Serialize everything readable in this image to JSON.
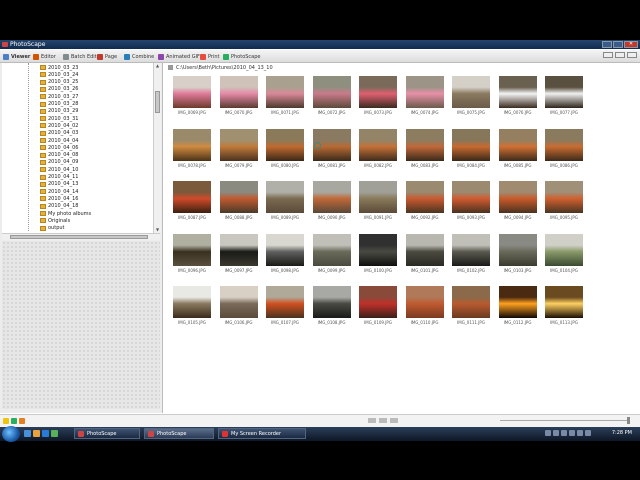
{
  "window": {
    "title": "PhotoScape"
  },
  "tabs": [
    {
      "label": "Viewer",
      "color": "#4a7fc8",
      "active": true
    },
    {
      "label": "Editor",
      "color": "#d35400"
    },
    {
      "label": "Batch Editor",
      "color": "#7f8c8d"
    },
    {
      "label": "Page",
      "color": "#c0392b"
    },
    {
      "label": "Combine",
      "color": "#2980b9"
    },
    {
      "label": "Animated GIF",
      "color": "#8e44ad"
    },
    {
      "label": "Print",
      "color": "#e74c3c"
    },
    {
      "label": "PhotoScape",
      "color": "#27ae60"
    }
  ],
  "tree": {
    "folders": [
      "2010_03_23",
      "2010_03_24",
      "2010_03_25",
      "2010_03_26",
      "2010_03_27",
      "2010_03_28",
      "2010_03_29",
      "2010_03_31",
      "2010_04_02",
      "2010_04_03",
      "2010_04_04",
      "2010_04_06",
      "2010_04_08",
      "2010_04_09",
      "2010_04_10",
      "2010_04_11",
      "2010_04_13",
      "2010_04_14",
      "2010_04_16",
      "2010_04_18",
      "My photo albums",
      "Originals",
      "output"
    ]
  },
  "path": "C:\\Users\\Beth\\Pictures\\2010_04_13_10",
  "thumbs": [
    {
      "name": "IMG_0069.JPG",
      "c1": "#d8d0c8",
      "c2": "#6b3a2a",
      "c3": "#e07a9a"
    },
    {
      "name": "IMG_0070.JPG",
      "c1": "#cfc2b8",
      "c2": "#5a3a30",
      "c3": "#e58aa8"
    },
    {
      "name": "IMG_0071.JPG",
      "c1": "#a9a090",
      "c2": "#4a3a2c",
      "c3": "#d98898"
    },
    {
      "name": "IMG_0072.JPG",
      "c1": "#8f8f80",
      "c2": "#5b4a3a",
      "c3": "#c97a8a"
    },
    {
      "name": "IMG_0073.JPG",
      "c1": "#7a6a5a",
      "c2": "#3a2a20",
      "c3": "#e06070"
    },
    {
      "name": "IMG_0074.JPG",
      "c1": "#9c9486",
      "c2": "#6a5a4a",
      "c3": "#e890a8"
    },
    {
      "name": "IMG_0075.JPG",
      "c1": "#d4d0c8",
      "c2": "#6a5a48",
      "c3": "#8a7a60"
    },
    {
      "name": "IMG_0076.JPG",
      "c1": "#6a6050",
      "c2": "#3a2a1e",
      "c3": "#f4f4f4"
    },
    {
      "name": "IMG_0077.JPG",
      "c1": "#5a5040",
      "c2": "#2e241a",
      "c3": "#f0f0f0"
    },
    {
      "name": "IMG_0078.JPG",
      "c1": "#9a8a6a",
      "c2": "#4a3218",
      "c3": "#d08a40"
    },
    {
      "name": "IMG_0079.JPG",
      "c1": "#a09070",
      "c2": "#4a3220",
      "c3": "#c07a3a"
    },
    {
      "name": "IMG_0080.JPG",
      "c1": "#8a7a5a",
      "c2": "#3a2818",
      "c3": "#c06a30"
    },
    {
      "name": "IMG_0081.JPG",
      "c1": "#8a7a62",
      "c2": "#3a2a1a",
      "c3": "#b86a34"
    },
    {
      "name": "IMG_0082.JPG",
      "c1": "#938468",
      "c2": "#3e2c1c",
      "c3": "#c47038"
    },
    {
      "name": "IMG_0083.JPG",
      "c1": "#8c7c60",
      "c2": "#3a2a1a",
      "c3": "#c0683a"
    },
    {
      "name": "IMG_0084.JPG",
      "c1": "#86765a",
      "c2": "#382818",
      "c3": "#c86a30"
    },
    {
      "name": "IMG_0085.JPG",
      "c1": "#948060",
      "c2": "#3a2a1a",
      "c3": "#d07034"
    },
    {
      "name": "IMG_0086.JPG",
      "c1": "#8a7a5e",
      "c2": "#3c2a1a",
      "c3": "#c86c32"
    },
    {
      "name": "IMG_0087.JPG",
      "c1": "#7a5a3a",
      "c2": "#3a2010",
      "c3": "#d04a2a"
    },
    {
      "name": "IMG_0088.JPG",
      "c1": "#8a8a80",
      "c2": "#4a3a2a",
      "c3": "#c05a30"
    },
    {
      "name": "IMG_0089.JPG",
      "c1": "#b0b0a8",
      "c2": "#5a4a3a",
      "c3": "#7a6a50"
    },
    {
      "name": "IMG_0090.JPG",
      "c1": "#a8a8a0",
      "c2": "#5a4838",
      "c3": "#c06838"
    },
    {
      "name": "IMG_0091.JPG",
      "c1": "#a0a098",
      "c2": "#5a4a38",
      "c3": "#8a7a5a"
    },
    {
      "name": "IMG_0092.JPG",
      "c1": "#9a8a70",
      "c2": "#4a3420",
      "c3": "#c85a30"
    },
    {
      "name": "IMG_0093.JPG",
      "c1": "#9c8a70",
      "c2": "#4a3220",
      "c3": "#d05a30"
    },
    {
      "name": "IMG_0094.JPG",
      "c1": "#a08a70",
      "c2": "#4a3220",
      "c3": "#c85a2a"
    },
    {
      "name": "IMG_0095.JPG",
      "c1": "#a09078",
      "c2": "#4a3422",
      "c3": "#d0602e"
    },
    {
      "name": "IMG_0096.JPG",
      "c1": "#b0b0a0",
      "c2": "#5a5040",
      "c3": "#3a3020"
    },
    {
      "name": "IMG_0097.JPG",
      "c1": "#c8c8c0",
      "c2": "#3a3a30",
      "c3": "#1a1a16"
    },
    {
      "name": "IMG_0098.JPG",
      "c1": "#d8d8d0",
      "c2": "#1a1a16",
      "c3": "#606060"
    },
    {
      "name": "IMG_0099.JPG",
      "c1": "#c0c0b8",
      "c2": "#4a4a40",
      "c3": "#6a6a5a"
    },
    {
      "name": "IMG_0100.JPG",
      "c1": "#303030",
      "c2": "#0e0e0c",
      "c3": "#4a4a44"
    },
    {
      "name": "IMG_0101.JPG",
      "c1": "#b8b8b0",
      "c2": "#2a2a24",
      "c3": "#4a4a40"
    },
    {
      "name": "IMG_0102.JPG",
      "c1": "#c0c0b8",
      "c2": "#1a1a18",
      "c3": "#5a5a50"
    },
    {
      "name": "IMG_0103.JPG",
      "c1": "#8a8a84",
      "c2": "#3a3a30",
      "c3": "#6a6a5a"
    },
    {
      "name": "IMG_0104.JPG",
      "c1": "#d0d0c8",
      "c2": "#3a4a30",
      "c3": "#8a9a6a"
    },
    {
      "name": "IMG_0105.JPG",
      "c1": "#e8e8e4",
      "c2": "#3a2a1a",
      "c3": "#8a7a60"
    },
    {
      "name": "IMG_0106.JPG",
      "c1": "#d8d0c4",
      "c2": "#5a4a3a",
      "c3": "#7a6a5a"
    },
    {
      "name": "IMG_0107.JPG",
      "c1": "#b0a898",
      "c2": "#4a3220",
      "c3": "#d05020"
    },
    {
      "name": "IMG_0108.JPG",
      "c1": "#a8a8a4",
      "c2": "#1a1a18",
      "c3": "#4a4a44"
    },
    {
      "name": "IMG_0109.JPG",
      "c1": "#8a4a3a",
      "c2": "#3a2018",
      "c3": "#c0302a"
    },
    {
      "name": "IMG_0110.JPG",
      "c1": "#b07a5a",
      "c2": "#7a3a20",
      "c3": "#c05a30"
    },
    {
      "name": "IMG_0111.JPG",
      "c1": "#8a6a4a",
      "c2": "#6a3a20",
      "c3": "#b85a30"
    },
    {
      "name": "IMG_0112.JPG",
      "c1": "#4a2a10",
      "c2": "#100804",
      "c3": "#ffa020"
    },
    {
      "name": "IMG_0113.JPG",
      "c1": "#6a4a20",
      "c2": "#1a0e04",
      "c3": "#ffd060"
    }
  ],
  "taskbar": {
    "buttons": [
      {
        "label": "PhotoScape",
        "color": "#c44"
      },
      {
        "label": "PhotoScape",
        "color": "#c44",
        "active": true
      },
      {
        "label": "My Screen Recorder",
        "color": "#d33"
      }
    ],
    "clock": "7:28 PM"
  }
}
